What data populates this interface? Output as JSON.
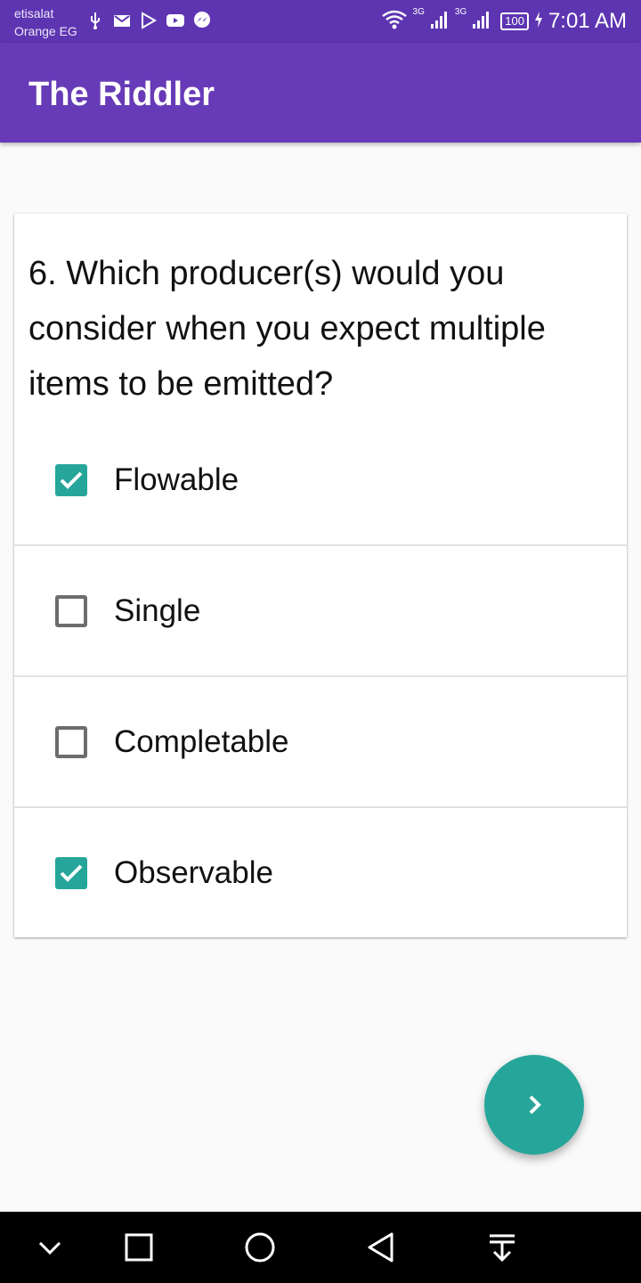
{
  "status_bar": {
    "carrier_line1": "etisalat",
    "carrier_line2": "Orange EG",
    "notification_icons": [
      "usb-icon",
      "gmail-icon",
      "play-store-icon",
      "youtube-icon",
      "messenger-icon"
    ],
    "network_label_1": "3G",
    "network_label_2": "3G",
    "battery": "100",
    "time": "7:01 AM"
  },
  "app_bar": {
    "title": "The Riddler"
  },
  "question": {
    "text": "6. Which producer(s) would you consider when you expect multiple items to be emitted?",
    "options": [
      {
        "label": "Flowable",
        "checked": true
      },
      {
        "label": "Single",
        "checked": false
      },
      {
        "label": "Completable",
        "checked": false
      },
      {
        "label": "Observable",
        "checked": true
      }
    ]
  },
  "fab": {
    "icon": "chevron-right-icon"
  },
  "nav_bar": {
    "buttons": [
      "collapse-icon",
      "recents-icon",
      "home-icon",
      "back-icon",
      "notification-pull-icon"
    ]
  },
  "colors": {
    "status_bar": "#5e35b1",
    "app_bar": "#673ab7",
    "accent": "#26a69a",
    "background": "#fafafa"
  }
}
